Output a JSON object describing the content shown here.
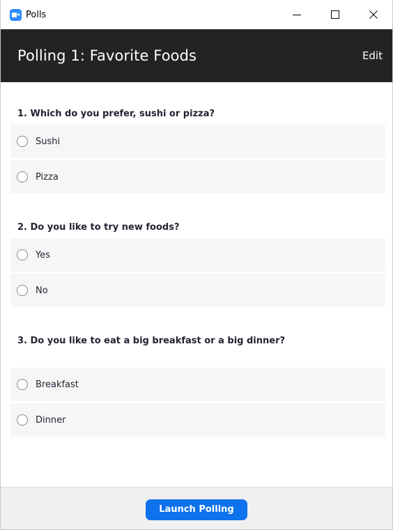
{
  "window": {
    "title": "Polls",
    "app_icon": "zoom-camera-icon",
    "controls": [
      "minimize-icon",
      "maximize-icon",
      "close-icon"
    ]
  },
  "header": {
    "title": "Polling 1: Favorite Foods",
    "edit_label": "Edit"
  },
  "questions": [
    {
      "text": "1. Which do you prefer, sushi or pizza?",
      "options": [
        "Sushi",
        "Pizza"
      ]
    },
    {
      "text": "2. Do you like to try new foods?",
      "options": [
        "Yes",
        "No"
      ]
    },
    {
      "text": "3. Do you like to eat a big breakfast or a big dinner?",
      "options": [
        "Breakfast",
        "Dinner"
      ]
    }
  ],
  "footer": {
    "launch_label": "Launch Polling"
  },
  "colors": {
    "header_bg": "#232323",
    "accent": "#0e72ed",
    "option_bg": "#f6f6f6",
    "footer_bg": "#f0f0f0"
  }
}
